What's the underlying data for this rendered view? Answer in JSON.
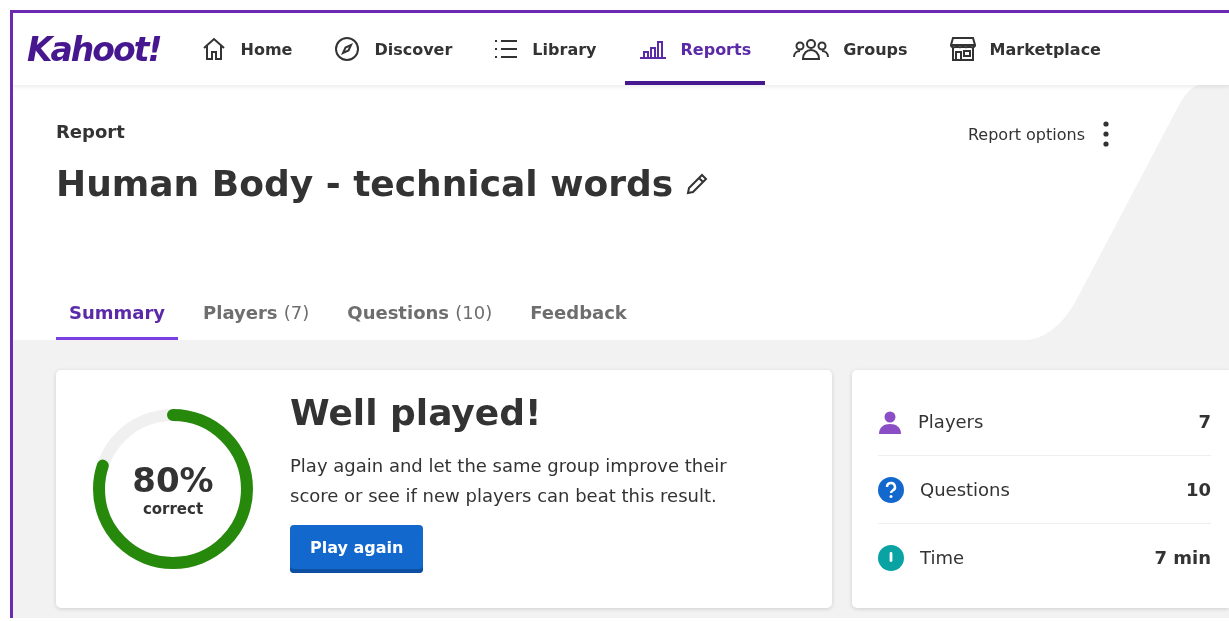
{
  "nav": {
    "logo": "Kahoot!",
    "items": [
      {
        "kind": "home",
        "label": "Home",
        "selected": false
      },
      {
        "kind": "compass",
        "label": "Discover",
        "selected": false
      },
      {
        "kind": "list",
        "label": "Library",
        "selected": false
      },
      {
        "kind": "chart",
        "label": "Reports",
        "selected": true
      },
      {
        "kind": "group",
        "label": "Groups",
        "selected": false
      },
      {
        "kind": "store",
        "label": "Marketplace",
        "selected": false
      }
    ]
  },
  "header": {
    "eyebrow": "Report",
    "title": "Human Body - technical words",
    "options": "Report options"
  },
  "tabs": [
    {
      "label": "Summary",
      "selected": true
    },
    {
      "label": "Players",
      "count": "(7)",
      "selected": false
    },
    {
      "label": "Questions",
      "count": "(10)",
      "selected": false
    },
    {
      "label": "Feedback",
      "selected": false
    }
  ],
  "summary": {
    "percent": "80%",
    "caption": "correct",
    "heading": "Well played!",
    "text": "Play again and let the same group improve their score or see if new players can beat this result.",
    "button": "Play again"
  },
  "stats": [
    {
      "kind": "person",
      "label": "Players",
      "value": "7",
      "color": "#8c4ec4"
    },
    {
      "kind": "question",
      "label": "Questions",
      "value": "10",
      "color": "#1368ce"
    },
    {
      "kind": "time",
      "label": "Time",
      "value": "7 min",
      "color": "#0aa3a3"
    }
  ]
}
